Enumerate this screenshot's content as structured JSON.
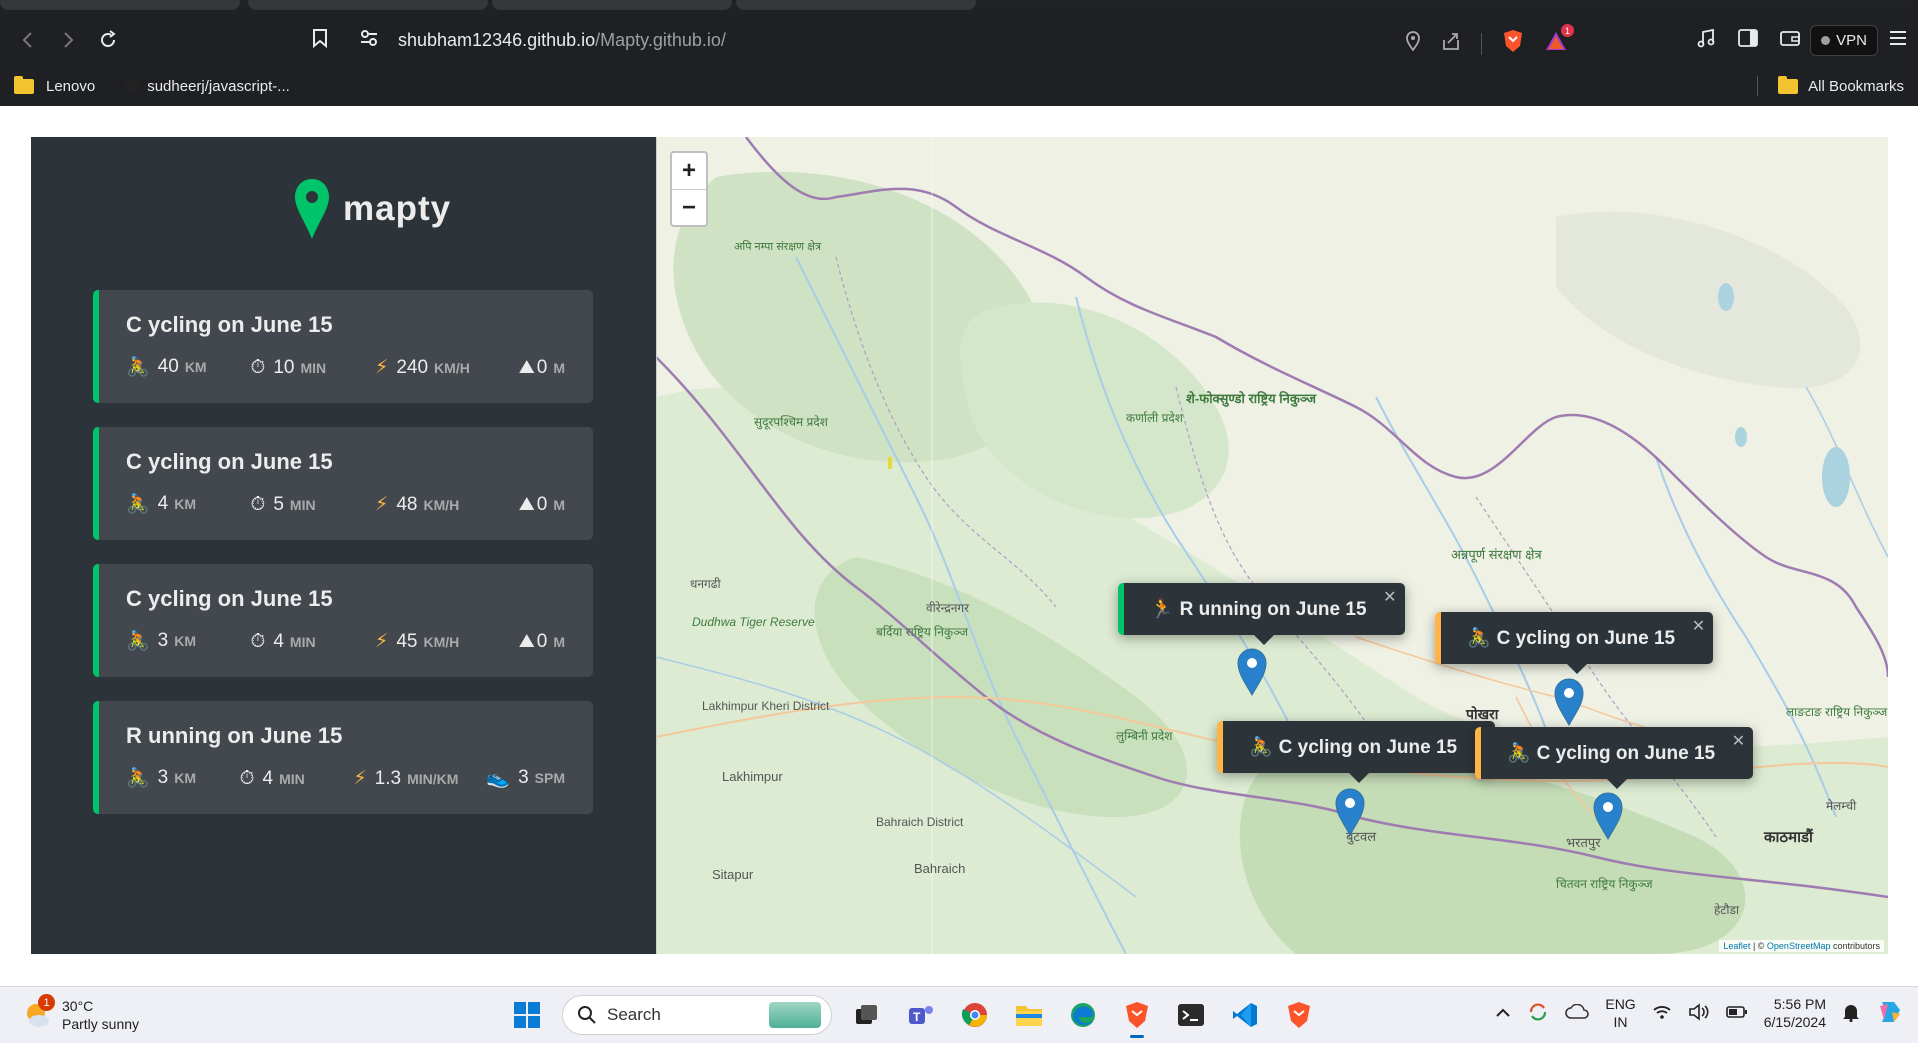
{
  "browser": {
    "url_host": "shubham12346.github.io",
    "url_path": "/Mapty.github.io/",
    "vpn_label": "VPN",
    "alert_count": "1",
    "bookmarks": [
      {
        "label": "Lenovo"
      },
      {
        "label": "sudheerj/javascript-..."
      }
    ],
    "all_bookmarks_label": "All Bookmarks"
  },
  "app": {
    "logo_text": "mapty",
    "brand_green": "#00c46a",
    "brand_yellow": "#ffb545",
    "workouts": [
      {
        "title": "C ycling on June 15",
        "type": "cycling",
        "d1": "40",
        "u1": "km",
        "d2": "10",
        "u2": "min",
        "d3": "240",
        "u3": "km/h",
        "d4": "0",
        "u4": "m"
      },
      {
        "title": "C ycling on June 15",
        "type": "cycling",
        "d1": "4",
        "u1": "km",
        "d2": "5",
        "u2": "min",
        "d3": "48",
        "u3": "km/h",
        "d4": "0",
        "u4": "m"
      },
      {
        "title": "C ycling on June 15",
        "type": "cycling",
        "d1": "3",
        "u1": "km",
        "d2": "4",
        "u2": "min",
        "d3": "45",
        "u3": "km/h",
        "d4": "0",
        "u4": "m"
      },
      {
        "title": "R unning on June 15",
        "type": "running",
        "d1": "3",
        "u1": "km",
        "d2": "4",
        "u2": "min",
        "d3": "1.3",
        "u3": "min/km",
        "d4": "3",
        "u4": "spm"
      }
    ]
  },
  "map": {
    "zoom_in": "+",
    "zoom_out": "−",
    "places": [
      "सुदूरपश्चिम प्रदेश",
      "कर्णाली प्रदेश",
      "शे-फोक्सुण्डो राष्ट्रिय निकुञ्ज",
      "अन्नपूर्ण संरक्षण क्षेत्र",
      "धनगढी",
      "Dudhwa Tiger Reserve",
      "वीरेन्द्रनगर",
      "बर्दिया राष्ट्रिय निकुञ्ज",
      "Lakhimpur Kheri District",
      "Lakhimpur",
      "लुम्बिनी प्रदेश",
      "पोखरा",
      "Bahraich District",
      "Bahraich",
      "Sitapur",
      "बुटवल",
      "भरतपुर",
      "चितवन राष्ट्रिय निकुञ्ज",
      "काठमाडौं",
      "मेलम्ची",
      "हेटौडा",
      "लाङटाङ राष्ट्रिय निकुञ्ज",
      "अपि नम्पा संरक्षण क्षेत्र"
    ],
    "popups": [
      {
        "label": "R unning on June 15",
        "type": "running"
      },
      {
        "label": "C ycling on June 15",
        "type": "cycling"
      },
      {
        "label": "C ycling on June 15",
        "type": "cycling"
      },
      {
        "label": "C ycling on June 15",
        "type": "cycling"
      }
    ],
    "attribution_leaflet": "Leaflet",
    "attribution_sep": " | © ",
    "attribution_osm": "OpenStreetMap",
    "attribution_rest": " contributors"
  },
  "taskbar": {
    "weather_temp": "30°C",
    "weather_desc": "Partly sunny",
    "weather_badge": "1",
    "search_label": "Search",
    "lang_1": "ENG",
    "lang_2": "IN",
    "time": "5:56 PM",
    "date": "6/15/2024"
  }
}
